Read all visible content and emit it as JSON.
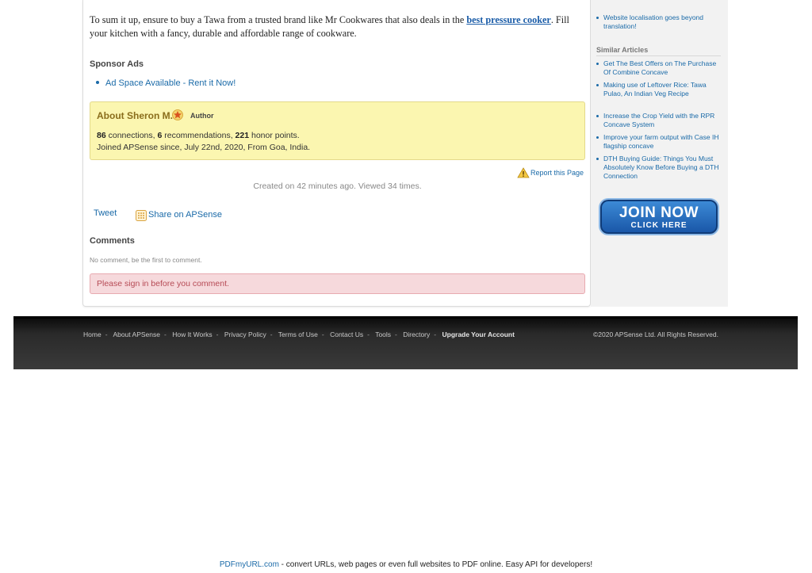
{
  "article": {
    "text_before_link": "To sum it up, ensure to buy a Tawa from a trusted brand like Mr Cookwares that also deals in the ",
    "link_text": "best pressure cooker",
    "text_after_link": ". Fill your kitchen with a fancy, durable and affordable range of cookware."
  },
  "sponsor": {
    "heading": "Sponsor Ads",
    "link": "Ad Space Available - Rent it Now!"
  },
  "author": {
    "about_label": "About",
    "name": "Sheron M.",
    "tag": "Author",
    "connections": "86",
    "connections_label": " connections, ",
    "recommendations": "6",
    "recommendations_label": " recommendations, ",
    "honor_points": "221",
    "honor_label": " honor points.",
    "joined": "Joined APSense since, July 22nd, 2020, From Goa, India."
  },
  "report": {
    "label": "Report this Page"
  },
  "created": "Created on 42 minutes ago. Viewed 34 times.",
  "social": {
    "tweet": "Tweet",
    "share": "Share on APSense"
  },
  "comments": {
    "heading": "Comments",
    "empty": "No comment, be the first to comment.",
    "signin": "Please sign in before you comment."
  },
  "sidebar": {
    "top_item": "Website localisation goes beyond translation!",
    "similar_heading": "Similar Articles",
    "similar": [
      "Get The Best Offers on The Purchase Of Combine Concave",
      "Making use of Leftover Rice: Tawa Pulao, An Indian Veg Recipe",
      "Increase the Crop Yield with the RPR Concave System",
      "Improve your farm output with Case IH flagship concave",
      "DTH Buying Guide: Things You Must Absolutely Know Before Buying a DTH Connection"
    ],
    "join": {
      "main": "JOIN NOW",
      "sub": "CLICK HERE"
    }
  },
  "footer": {
    "links": [
      "Home",
      "About APSense",
      "How It Works",
      "Privacy Policy",
      "Terms of Use",
      "Contact Us",
      "Tools",
      "Directory"
    ],
    "upgrade": "Upgrade Your Account",
    "separator": "-",
    "copyright": "©2020 APSense Ltd. All Rights Reserved."
  },
  "pdf_banner": {
    "link": "PDFmyURL.com",
    "text": " - convert URLs, web pages or even full websites to PDF online. Easy API for developers!"
  }
}
